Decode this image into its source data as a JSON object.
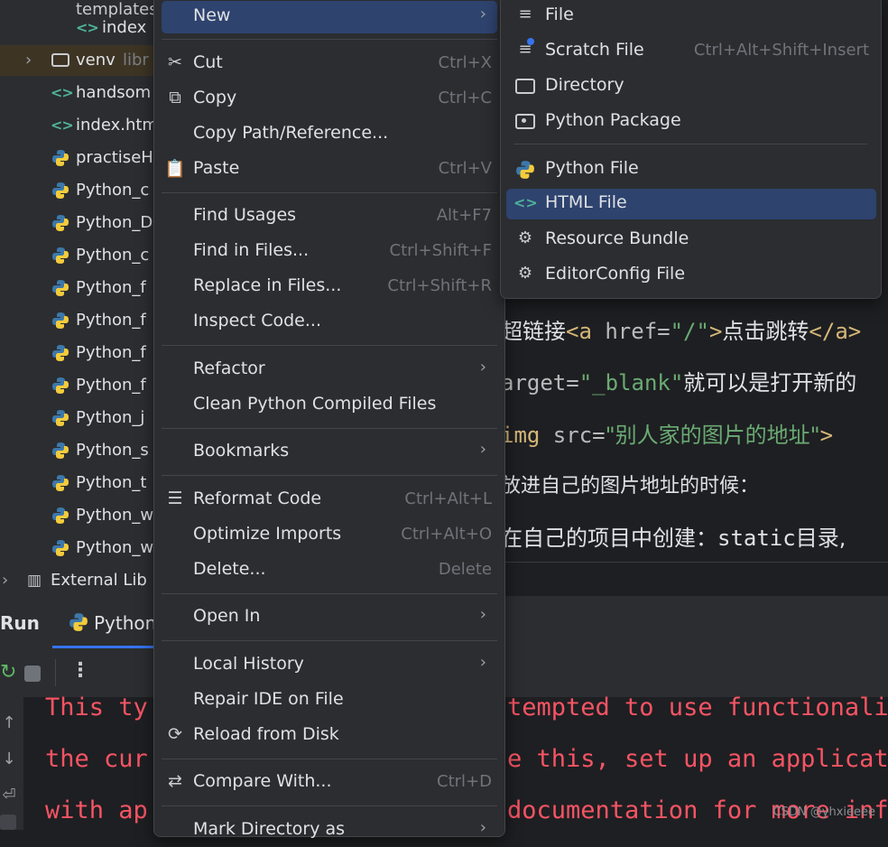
{
  "colors": {
    "accent": "#3574f0",
    "selection": "#2e436e",
    "error_text": "#f75464",
    "html_icon": "#4fb29a"
  },
  "project_tree": {
    "items": [
      {
        "label": "index",
        "icon": "html-icon"
      },
      {
        "label": "venv",
        "suffix": "libr",
        "icon": "folder-icon"
      },
      {
        "label": "handsom",
        "icon": "html-icon"
      },
      {
        "label": "index.htm",
        "icon": "html-icon"
      },
      {
        "label": "practiseH",
        "icon": "python-icon"
      },
      {
        "label": "Python_c",
        "icon": "python-icon"
      },
      {
        "label": "Python_D",
        "icon": "python-icon"
      },
      {
        "label": "Python_c",
        "icon": "python-icon"
      },
      {
        "label": "Python_f",
        "icon": "python-icon"
      },
      {
        "label": "Python_f",
        "icon": "python-icon"
      },
      {
        "label": "Python_f",
        "icon": "python-icon"
      },
      {
        "label": "Python_f",
        "icon": "python-icon"
      },
      {
        "label": "Python_j",
        "icon": "python-icon"
      },
      {
        "label": "Python_s",
        "icon": "python-icon"
      },
      {
        "label": "Python_t",
        "icon": "python-icon"
      },
      {
        "label": "Python_w",
        "icon": "python-icon"
      },
      {
        "label": "Python_w",
        "icon": "python-icon"
      },
      {
        "label": "External Lib",
        "icon": "library-icon"
      }
    ]
  },
  "editor": {
    "line1": {
      "a": "超链接",
      "b": "<a ",
      "c": "href=",
      "d": "\"/\"",
      "e": ">",
      "f": "点击跳转",
      "g": "</a>"
    },
    "line2": {
      "a": "arget=",
      "b": "\"_blank\"",
      "c": "就可以是打开新的"
    },
    "line3": {
      "a": "img ",
      "b": "src=",
      "c": "\"别人家的图片的地址\"",
      "d": ">"
    },
    "line4": "放进自己的图片地址的时候：",
    "line5": {
      "a": "在自己的项目中创建：",
      "b": "static",
      "c": "目录,"
    }
  },
  "run_window": {
    "title": "Run",
    "tab_label": "Python",
    "console_lines": [
      "This ty",
      "the cur",
      "with ap",
      "tempted to use functionalit",
      "e this, set up an applicati",
      "documentation for more info"
    ]
  },
  "context_menu": {
    "new": {
      "label": "New"
    },
    "cut": {
      "label": "Cut",
      "shortcut": "Ctrl+X"
    },
    "copy": {
      "label": "Copy",
      "shortcut": "Ctrl+C"
    },
    "copy_path": {
      "label": "Copy Path/Reference..."
    },
    "paste": {
      "label": "Paste",
      "shortcut": "Ctrl+V"
    },
    "find_usages": {
      "label": "Find Usages",
      "shortcut": "Alt+F7"
    },
    "find_in_files": {
      "label": "Find in Files...",
      "shortcut": "Ctrl+Shift+F"
    },
    "replace_in_files": {
      "label": "Replace in Files...",
      "shortcut": "Ctrl+Shift+R"
    },
    "inspect_code": {
      "label": "Inspect Code..."
    },
    "refactor": {
      "label": "Refactor"
    },
    "clean_compiled": {
      "label": "Clean Python Compiled Files"
    },
    "bookmarks": {
      "label": "Bookmarks"
    },
    "reformat_code": {
      "label": "Reformat Code",
      "shortcut": "Ctrl+Alt+L"
    },
    "optimize_imports": {
      "label": "Optimize Imports",
      "shortcut": "Ctrl+Alt+O"
    },
    "delete": {
      "label": "Delete...",
      "shortcut": "Delete"
    },
    "open_in": {
      "label": "Open In"
    },
    "local_history": {
      "label": "Local History"
    },
    "repair_ide": {
      "label": "Repair IDE on File"
    },
    "reload": {
      "label": "Reload from Disk"
    },
    "compare_with": {
      "label": "Compare With...",
      "shortcut": "Ctrl+D"
    },
    "mark_directory": {
      "label": "Mark Directory as"
    }
  },
  "submenu_new": {
    "file": {
      "label": "File"
    },
    "scratch_file": {
      "label": "Scratch File",
      "shortcut": "Ctrl+Alt+Shift+Insert"
    },
    "directory": {
      "label": "Directory"
    },
    "python_package": {
      "label": "Python Package"
    },
    "python_file": {
      "label": "Python File"
    },
    "html_file": {
      "label": "HTML File"
    },
    "resource_bundle": {
      "label": "Resource Bundle"
    },
    "editorconfig_file": {
      "label": "EditorConfig File"
    }
  },
  "watermark": "CSDN @yhxieeee"
}
